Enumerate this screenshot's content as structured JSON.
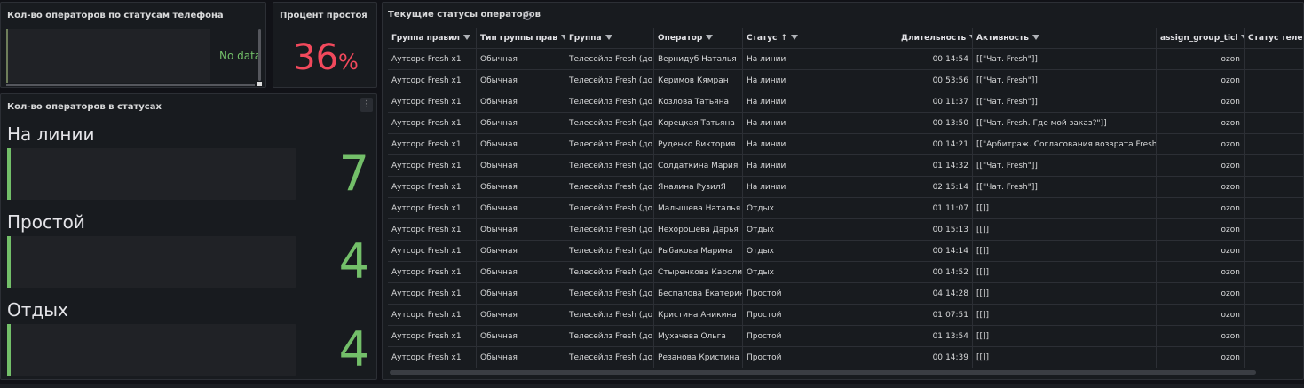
{
  "panels": {
    "phone_status": {
      "title": "Кол-во операторов по статусам телефона",
      "empty_text": "No data"
    },
    "idle_percent": {
      "title": "Процент простоя",
      "value": "36",
      "unit": "%"
    },
    "operators_in_status": {
      "title": "Кол-во операторов в статусах",
      "menu_icon": "kebab-icon",
      "items": [
        {
          "label": "На линии",
          "value": "7"
        },
        {
          "label": "Простой",
          "value": "4"
        },
        {
          "label": "Отдых",
          "value": "4"
        }
      ]
    },
    "current_statuses": {
      "title": "Текущие статусы операторов",
      "info_icon": "info-icon",
      "columns": [
        {
          "label": "Группа правил",
          "filter": true
        },
        {
          "label": "Тип группы прав",
          "filter": true
        },
        {
          "label": "Группа",
          "filter": true
        },
        {
          "label": "Оператор",
          "filter": true
        },
        {
          "label": "Статус",
          "filter": true,
          "sort": "↑"
        },
        {
          "label": "Длительность",
          "filter": true
        },
        {
          "label": "Активность",
          "filter": true
        },
        {
          "label": "assign_group_ticl",
          "filter": true
        },
        {
          "label": "Статус теле",
          "filter": false
        }
      ],
      "rows": [
        [
          "Аутсорс Fresh x1",
          "Обычная",
          "Телесейлз Fresh (до",
          "Вернидуб Наталья",
          "На линии",
          "00:14:54",
          "[[\"Чат. Fresh\"]]",
          "ozon",
          ""
        ],
        [
          "Аутсорс Fresh x1",
          "Обычная",
          "Телесейлз Fresh (до",
          "Керимов Кямран",
          "На линии",
          "00:53:56",
          "[[\"Чат. Fresh\"]]",
          "ozon",
          ""
        ],
        [
          "Аутсорс Fresh x1",
          "Обычная",
          "Телесейлз Fresh (до",
          "Козлова Татьяна",
          "На линии",
          "00:11:37",
          "[[\"Чат. Fresh\"]]",
          "ozon",
          ""
        ],
        [
          "Аутсорс Fresh x1",
          "Обычная",
          "Телесейлз Fresh (до",
          "Корецкая Татьяна",
          "На линии",
          "00:13:50",
          "[[\"Чат. Fresh. Где мой заказ?\"]]",
          "ozon",
          ""
        ],
        [
          "Аутсорс Fresh x1",
          "Обычная",
          "Телесейлз Fresh (до",
          "Руденко Виктория",
          "На линии",
          "00:14:21",
          "[[\"Арбитраж. Согласования возврата Fresh",
          "ozon",
          ""
        ],
        [
          "Аутсорс Fresh x1",
          "Обычная",
          "Телесейлз Fresh (до",
          "Солдаткина Мария",
          "На линии",
          "01:14:32",
          "[[\"Чат. Fresh\"]]",
          "ozon",
          ""
        ],
        [
          "Аутсорс Fresh x1",
          "Обычная",
          "Телесейлз Fresh (до",
          "Яналина РузилЯ",
          "На линии",
          "02:15:14",
          "[[\"Чат. Fresh\"]]",
          "ozon",
          ""
        ],
        [
          "Аутсорс Fresh x1",
          "Обычная",
          "Телесейлз Fresh (до",
          "Малышева Наталья",
          "Отдых",
          "01:11:07",
          "[[]]",
          "ozon",
          ""
        ],
        [
          "Аутсорс Fresh x1",
          "Обычная",
          "Телесейлз Fresh (до",
          "Нехорошева Дарья",
          "Отдых",
          "00:15:13",
          "[[]]",
          "ozon",
          ""
        ],
        [
          "Аутсорс Fresh x1",
          "Обычная",
          "Телесейлз Fresh (до",
          "Рыбакова Марина",
          "Отдых",
          "00:14:14",
          "[[]]",
          "ozon",
          ""
        ],
        [
          "Аутсорс Fresh x1",
          "Обычная",
          "Телесейлз Fresh (до",
          "Стыренкова Каролин",
          "Отдых",
          "00:14:52",
          "[[]]",
          "ozon",
          ""
        ],
        [
          "Аутсорс Fresh x1",
          "Обычная",
          "Телесейлз Fresh (до",
          "Беспалова Екатерин",
          "Простой",
          "04:14:28",
          "[[]]",
          "ozon",
          ""
        ],
        [
          "Аутсорс Fresh x1",
          "Обычная",
          "Телесейлз Fresh (до",
          "Кристина Аникина",
          "Простой",
          "01:07:51",
          "[[]]",
          "ozon",
          ""
        ],
        [
          "Аутсорс Fresh x1",
          "Обычная",
          "Телесейлз Fresh (до",
          "Мухачева Ольга",
          "Простой",
          "01:13:54",
          "[[]]",
          "ozon",
          ""
        ],
        [
          "Аутсорс Fresh x1",
          "Обычная",
          "Телесейлз Fresh (до",
          "Резанова Кристина",
          "Простой",
          "00:14:39",
          "[[]]",
          "ozon",
          ""
        ]
      ]
    }
  },
  "colors": {
    "background": "#111217",
    "panel": "#181b1f",
    "green": "#73bf69",
    "red": "#f2495c"
  }
}
